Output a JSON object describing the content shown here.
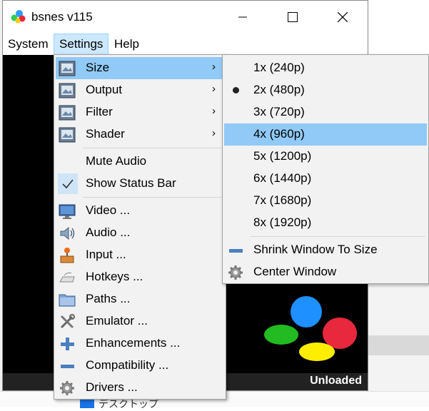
{
  "window": {
    "title": "bsnes v115",
    "controls": {
      "minimize": "minimize",
      "maximize": "maximize",
      "close": "close"
    }
  },
  "menubar": {
    "system": "System",
    "settings": "Settings",
    "help": "Help"
  },
  "status_bar": {
    "text": "Unloaded"
  },
  "settings_menu": {
    "items": [
      {
        "label": "Size",
        "icon": "display-icon",
        "submenu": true,
        "highlighted": true
      },
      {
        "label": "Output",
        "icon": "display-icon",
        "submenu": true
      },
      {
        "label": "Filter",
        "icon": "display-icon",
        "submenu": true
      },
      {
        "label": "Shader",
        "icon": "display-icon",
        "submenu": true
      },
      {
        "label": "Mute Audio",
        "checked": false
      },
      {
        "label": "Show Status Bar",
        "checked": true
      },
      {
        "label": "Video ...",
        "icon": "monitor-icon"
      },
      {
        "label": "Audio ...",
        "icon": "speaker-icon"
      },
      {
        "label": "Input ...",
        "icon": "joystick-icon"
      },
      {
        "label": "Hotkeys ...",
        "icon": "keyboard-icon"
      },
      {
        "label": "Paths ...",
        "icon": "folder-icon"
      },
      {
        "label": "Emulator ...",
        "icon": "tools-icon"
      },
      {
        "label": "Enhancements ...",
        "icon": "plus-icon"
      },
      {
        "label": "Compatibility ...",
        "icon": "minus-icon"
      },
      {
        "label": "Drivers ...",
        "icon": "gear-icon"
      }
    ]
  },
  "size_menu": {
    "items": [
      {
        "label": "1x (240p)"
      },
      {
        "label": "2x (480p)",
        "selected": true
      },
      {
        "label": "3x (720p)"
      },
      {
        "label": "4x (960p)",
        "highlighted": true
      },
      {
        "label": "5x (1200p)"
      },
      {
        "label": "6x (1440p)"
      },
      {
        "label": "7x (1680p)"
      },
      {
        "label": "8x (1920p)"
      },
      {
        "label": "Shrink Window To Size",
        "icon": "minus-icon"
      },
      {
        "label": "Center Window",
        "icon": "gear-icon"
      }
    ]
  },
  "colors": {
    "highlight": "#91c9f7",
    "snes_blue": "#1e90ff",
    "snes_red": "#e8283c",
    "snes_green": "#22bb22",
    "snes_yellow": "#ffee00"
  },
  "background": {
    "partial_text": "デスクトップ"
  }
}
